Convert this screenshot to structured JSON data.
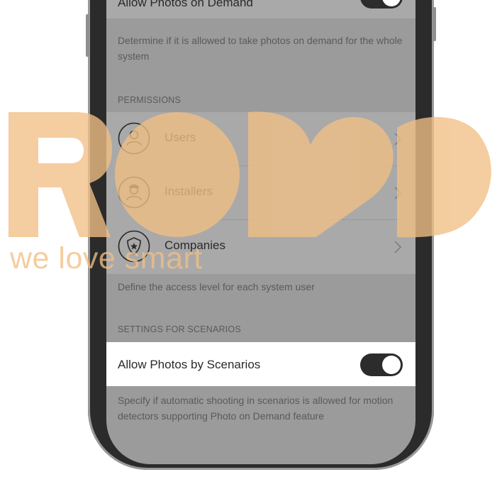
{
  "top_row": {
    "label": "Allow Photos on Demand",
    "toggle_on": true,
    "description": "Determine if it is allowed to take photos on demand for the whole system"
  },
  "permissions": {
    "section_title": "PERMISSIONS",
    "items": [
      {
        "label": "Users",
        "icon": "user-icon"
      },
      {
        "label": "Installers",
        "icon": "installer-icon"
      },
      {
        "label": "Companies",
        "icon": "company-shield-icon"
      }
    ],
    "description": "Define the access level for each system user"
  },
  "scenarios": {
    "section_title": "SETTINGS FOR SCENARIOS",
    "label": "Allow Photos by Scenarios",
    "toggle_on": true,
    "description": "Specify if automatic shooting in scenarios is allowed for motion detectors supporting Photo on Demand feature"
  },
  "watermark": {
    "logo_letters": "ROBB",
    "tagline": "we love smart",
    "color": "#f1bf85"
  }
}
